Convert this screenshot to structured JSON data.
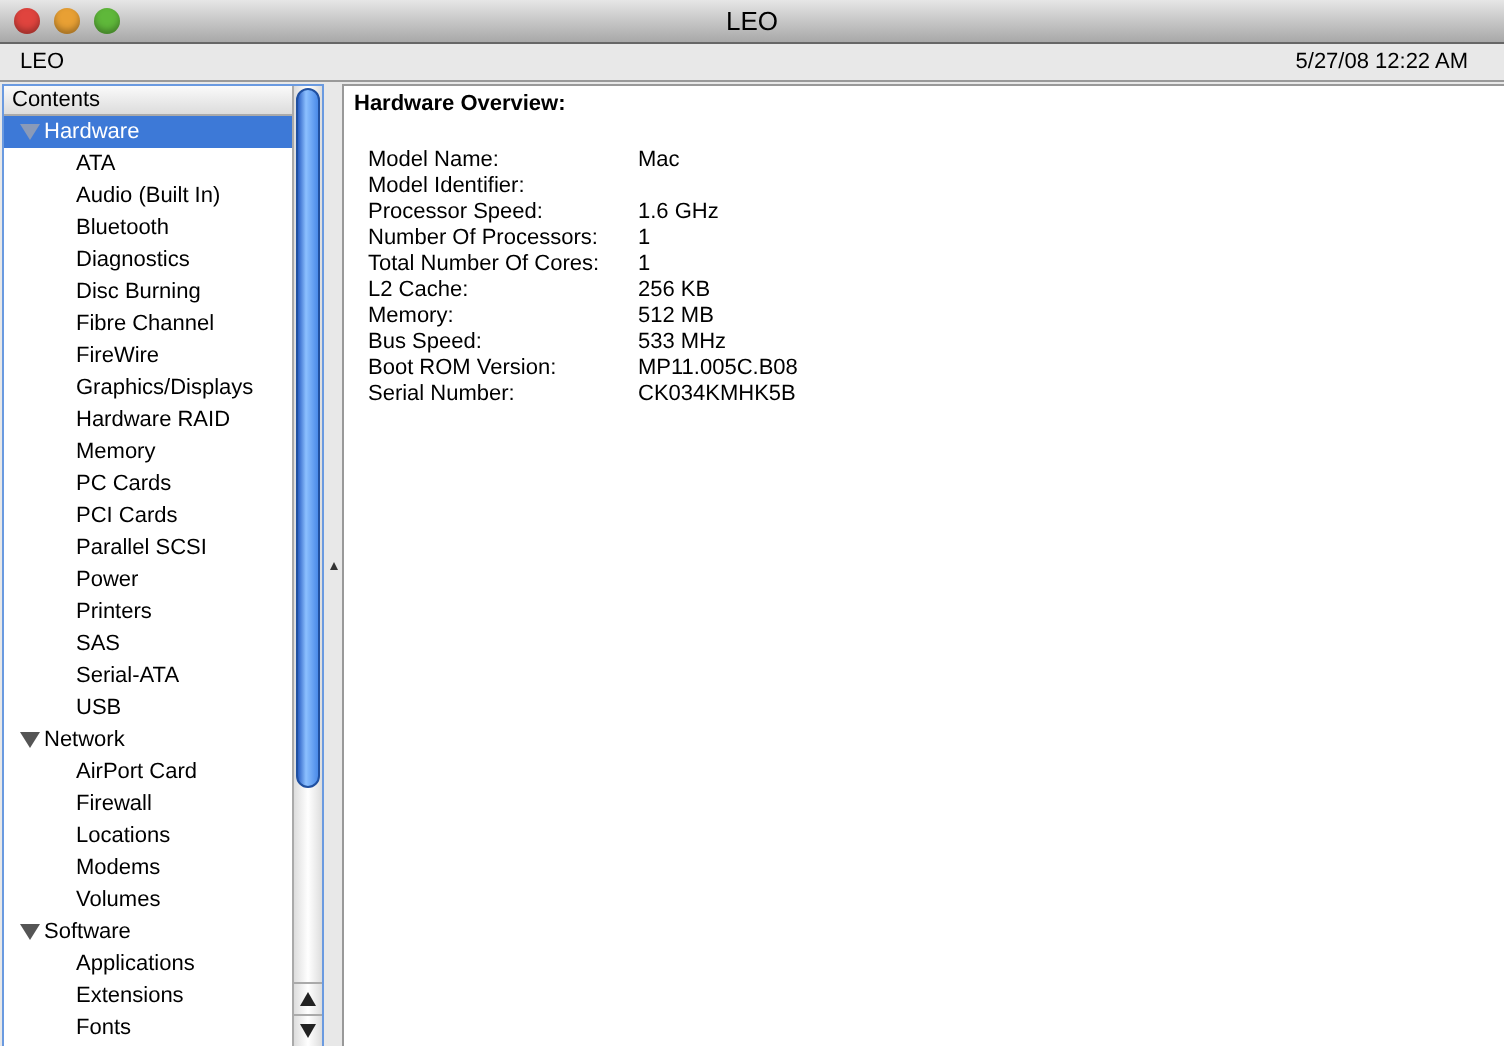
{
  "window": {
    "title": "LEO"
  },
  "info_bar": {
    "computer": "LEO",
    "timestamp": "5/27/08 12:22 AM"
  },
  "sidebar": {
    "header": "Contents",
    "items": [
      {
        "label": "Hardware",
        "expanded": true,
        "selected": true,
        "children": [
          {
            "label": "ATA",
            "selected": false
          },
          {
            "label": "Audio (Built In)",
            "selected": false
          },
          {
            "label": "Bluetooth",
            "selected": false
          },
          {
            "label": "Diagnostics",
            "selected": false
          },
          {
            "label": "Disc Burning",
            "selected": false
          },
          {
            "label": "Fibre Channel",
            "selected": false
          },
          {
            "label": "FireWire",
            "selected": false
          },
          {
            "label": "Graphics/Displays",
            "selected": false
          },
          {
            "label": "Hardware RAID",
            "selected": false
          },
          {
            "label": "Memory",
            "selected": false
          },
          {
            "label": "PC Cards",
            "selected": false
          },
          {
            "label": "PCI Cards",
            "selected": false
          },
          {
            "label": "Parallel SCSI",
            "selected": false
          },
          {
            "label": "Power",
            "selected": false
          },
          {
            "label": "Printers",
            "selected": false
          },
          {
            "label": "SAS",
            "selected": false
          },
          {
            "label": "Serial-ATA",
            "selected": false
          },
          {
            "label": "USB",
            "selected": false
          }
        ]
      },
      {
        "label": "Network",
        "expanded": true,
        "selected": false,
        "children": [
          {
            "label": "AirPort Card",
            "selected": false
          },
          {
            "label": "Firewall",
            "selected": false
          },
          {
            "label": "Locations",
            "selected": false
          },
          {
            "label": "Modems",
            "selected": false
          },
          {
            "label": "Volumes",
            "selected": false
          }
        ]
      },
      {
        "label": "Software",
        "expanded": true,
        "selected": false,
        "children": [
          {
            "label": "Applications",
            "selected": false
          },
          {
            "label": "Extensions",
            "selected": false
          },
          {
            "label": "Fonts",
            "selected": false
          }
        ]
      }
    ]
  },
  "detail": {
    "title": "Hardware Overview:",
    "rows": [
      {
        "label": "Model Name:",
        "value": "Mac"
      },
      {
        "label": "Model Identifier:"
      },
      {
        "label": "Processor Speed:",
        "value": "1.6 GHz"
      },
      {
        "label": "Number Of Processors:",
        "value": "1"
      },
      {
        "label": "Total Number Of Cores:",
        "value": "1"
      },
      {
        "label": "L2 Cache:",
        "value": "256 KB"
      },
      {
        "label": "Memory:",
        "value": "512 MB"
      },
      {
        "label": "Bus Speed:",
        "value": "533 MHz"
      },
      {
        "label": "Boot ROM Version:",
        "value": "MP11.005C.B08"
      },
      {
        "label": "Serial Number:",
        "value": "CK034KMHK5B"
      }
    ]
  }
}
